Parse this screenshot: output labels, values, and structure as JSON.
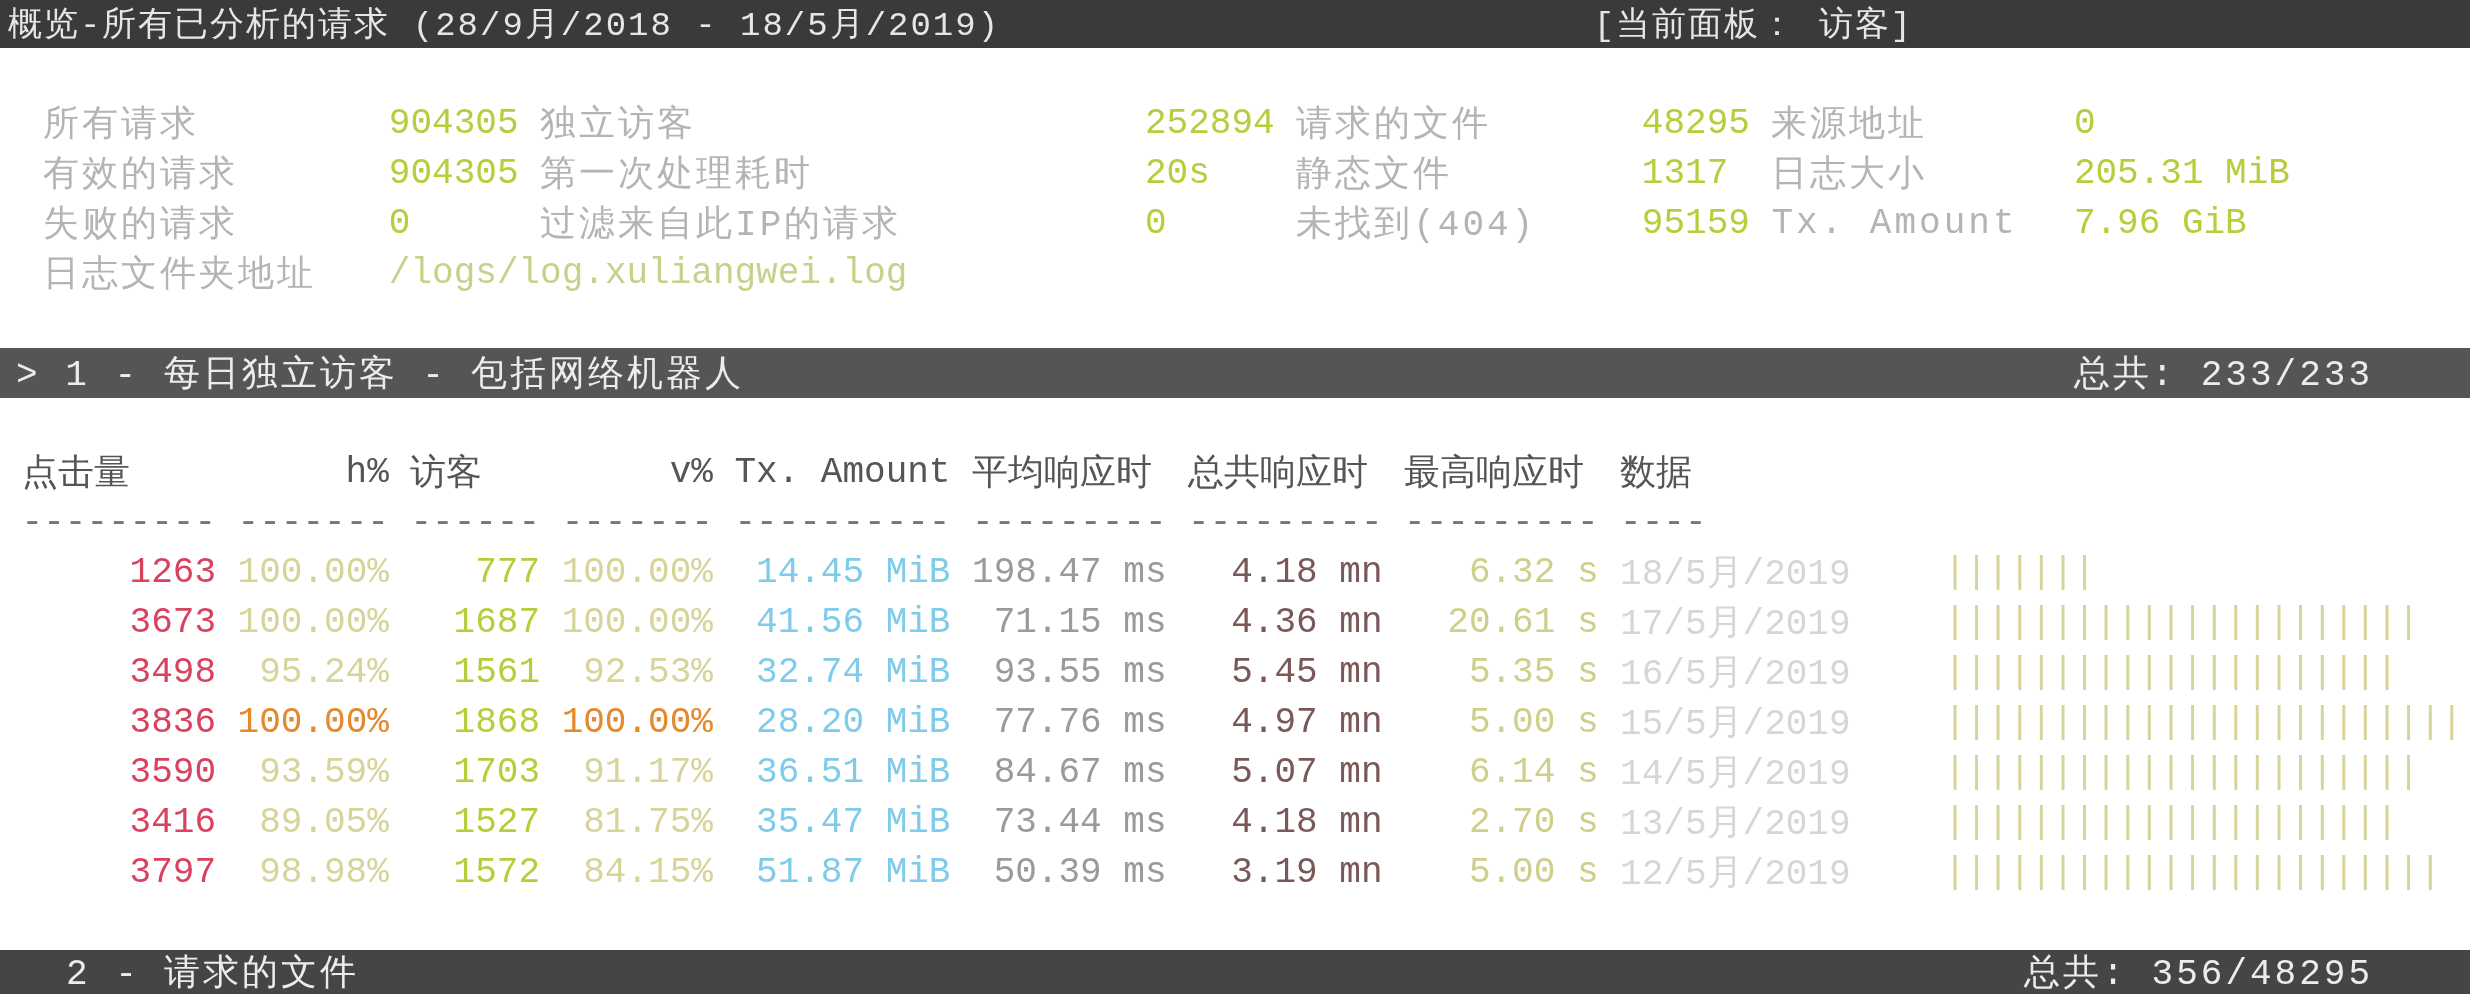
{
  "title_bar": {
    "title": "概览-所有已分析的请求 (28/9月/2018 - 18/5月/2019)",
    "panel": "[当前面板： 访客]"
  },
  "overview": [
    {
      "label": "所有请求",
      "value": "904305",
      "kind": "metric"
    },
    {
      "label": "独立访客",
      "value": "252894",
      "kind": "metric"
    },
    {
      "label": "请求的文件",
      "value": "48295",
      "kind": "metric"
    },
    {
      "label": "来源地址",
      "value": "0",
      "kind": "metric"
    },
    {
      "label": "有效的请求",
      "value": "904305",
      "kind": "metric"
    },
    {
      "label": "第一次处理耗时",
      "value": "20s",
      "kind": "metric"
    },
    {
      "label": "静态文件",
      "value": "1317",
      "kind": "metric"
    },
    {
      "label": "日志大小",
      "value": "205.31 MiB",
      "kind": "metric"
    },
    {
      "label": "失败的请求",
      "value": "0",
      "kind": "metric"
    },
    {
      "label": "过滤来自此IP的请求",
      "value": "0",
      "kind": "metric"
    },
    {
      "label": "未找到(404)",
      "value": "95159",
      "kind": "metric"
    },
    {
      "label": "Tx. Amount",
      "value": "7.96 GiB",
      "kind": "metric"
    },
    {
      "label": "日志文件夹地址",
      "value": "/logs/log.xuliangwei.log",
      "kind": "path"
    }
  ],
  "panel_1": {
    "heading": "> 1 - 每日独立访客 - 包括网络机器人",
    "total": "总共: 233/233"
  },
  "table": {
    "columns": [
      {
        "header": "点击量",
        "separator": "---------"
      },
      {
        "header": "h%",
        "separator": "-------"
      },
      {
        "header": "访客",
        "separator": "------"
      },
      {
        "header": "v%",
        "separator": "-------"
      },
      {
        "header": "Tx. Amount",
        "separator": "----------"
      },
      {
        "header": "平均响应时",
        "separator": "---------"
      },
      {
        "header": "总共响应时",
        "separator": "---------"
      },
      {
        "header": "最高响应时",
        "separator": "---------"
      },
      {
        "header": "数据",
        "separator": "----"
      }
    ],
    "rows": [
      {
        "hits": "1263",
        "hits_pct": "100.00%",
        "visitors": "777",
        "visitors_pct": "100.00%",
        "tx": "14.45 MiB",
        "avg": "198.47 ms",
        "cum": "4.18 mn",
        "max": "6.32 s",
        "date": "18/5月/2019",
        "bar": "|||||||",
        "highlight": false
      },
      {
        "hits": "3673",
        "hits_pct": "100.00%",
        "visitors": "1687",
        "visitors_pct": "100.00%",
        "tx": "41.56 MiB",
        "avg": "71.15 ms",
        "cum": "4.36 mn",
        "max": "20.61 s",
        "date": "17/5月/2019",
        "bar": "||||||||||||||||||||||",
        "highlight": false
      },
      {
        "hits": "3498",
        "hits_pct": "95.24%",
        "visitors": "1561",
        "visitors_pct": "92.53%",
        "tx": "32.74 MiB",
        "avg": "93.55 ms",
        "cum": "5.45 mn",
        "max": "5.35 s",
        "date": "16/5月/2019",
        "bar": "|||||||||||||||||||||",
        "highlight": false
      },
      {
        "hits": "3836",
        "hits_pct": "100.00%",
        "visitors": "1868",
        "visitors_pct": "100.00%",
        "tx": "28.20 MiB",
        "avg": "77.76 ms",
        "cum": "4.97 mn",
        "max": "5.00 s",
        "date": "15/5月/2019",
        "bar": "||||||||||||||||||||||||",
        "highlight": true
      },
      {
        "hits": "3590",
        "hits_pct": "93.59%",
        "visitors": "1703",
        "visitors_pct": "91.17%",
        "tx": "36.51 MiB",
        "avg": "84.67 ms",
        "cum": "5.07 mn",
        "max": "6.14 s",
        "date": "14/5月/2019",
        "bar": "||||||||||||||||||||||",
        "highlight": false
      },
      {
        "hits": "3416",
        "hits_pct": "89.05%",
        "visitors": "1527",
        "visitors_pct": "81.75%",
        "tx": "35.47 MiB",
        "avg": "73.44 ms",
        "cum": "4.18 mn",
        "max": "2.70 s",
        "date": "13/5月/2019",
        "bar": "|||||||||||||||||||||",
        "highlight": false
      },
      {
        "hits": "3797",
        "hits_pct": "98.98%",
        "visitors": "1572",
        "visitors_pct": "84.15%",
        "tx": "51.87 MiB",
        "avg": "50.39 ms",
        "cum": "3.19 mn",
        "max": "5.00 s",
        "date": "12/5月/2019",
        "bar": "|||||||||||||||||||||||",
        "highlight": false
      }
    ]
  },
  "panel_2": {
    "heading": "2 - 请求的文件",
    "total": "总共: 356/48295"
  }
}
